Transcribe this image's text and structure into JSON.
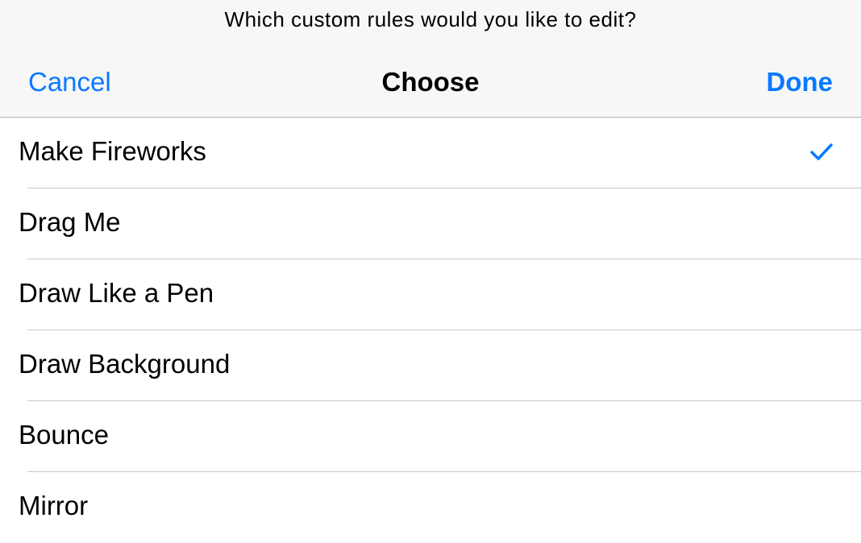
{
  "header": {
    "prompt": "Which custom rules would you like to edit?",
    "cancel_label": "Cancel",
    "title": "Choose",
    "done_label": "Done"
  },
  "rules": [
    {
      "label": "Make Fireworks",
      "selected": true
    },
    {
      "label": "Drag Me",
      "selected": false
    },
    {
      "label": "Draw Like a Pen",
      "selected": false
    },
    {
      "label": "Draw Background",
      "selected": false
    },
    {
      "label": "Bounce",
      "selected": false
    },
    {
      "label": "Mirror",
      "selected": false
    }
  ],
  "colors": {
    "accent": "#0a7aff",
    "nav_background": "#f7f7f7",
    "separator": "#c8c7cc"
  },
  "icons": {
    "selected_indicator": "checkmark-icon"
  }
}
